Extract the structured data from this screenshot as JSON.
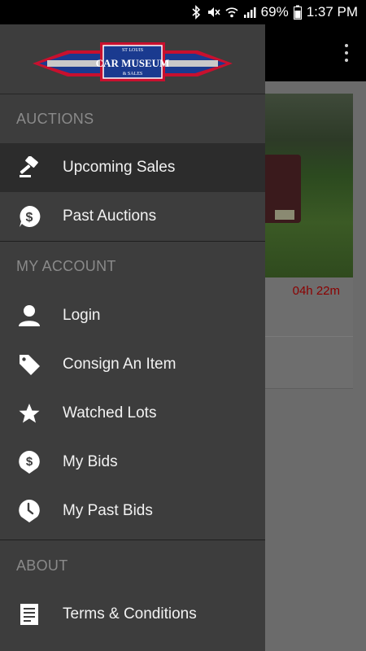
{
  "status_bar": {
    "battery_percent": "69%",
    "time": "1:37 PM",
    "icons": [
      "bluetooth-icon",
      "mute-icon",
      "wifi-icon",
      "signal-icon",
      "battery-icon"
    ]
  },
  "logo": {
    "line1": "ST LOUIS",
    "line2": "CAR MUSEUM",
    "line3": "& SALES"
  },
  "background": {
    "timer": "04h 22m"
  },
  "drawer": {
    "sections": [
      {
        "title": "AUCTIONS"
      },
      {
        "title": "MY ACCOUNT"
      },
      {
        "title": "ABOUT"
      }
    ],
    "items": [
      {
        "label": "Upcoming Sales",
        "icon": "gavel-icon",
        "active": true
      },
      {
        "label": "Past Auctions",
        "icon": "dollar-bubble-icon"
      },
      {
        "label": "Login",
        "icon": "person-icon"
      },
      {
        "label": "Consign An Item",
        "icon": "tag-icon"
      },
      {
        "label": "Watched Lots",
        "icon": "star-icon"
      },
      {
        "label": "My Bids",
        "icon": "dollar-bubble-icon"
      },
      {
        "label": "My Past Bids",
        "icon": "clock-bubble-icon"
      },
      {
        "label": "Terms & Conditions",
        "icon": "document-icon"
      }
    ]
  },
  "colors": {
    "drawer_bg": "#3d3d3d",
    "active_item_bg": "#2c2c2c",
    "section_label": "#8a8a8a",
    "timer_red": "#8b0000"
  }
}
